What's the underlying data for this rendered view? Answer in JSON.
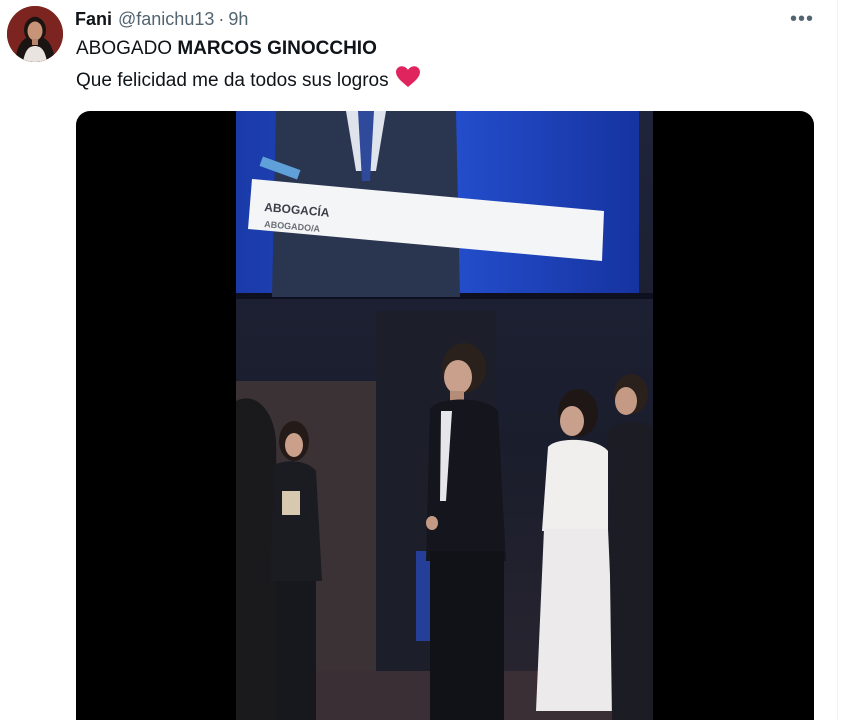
{
  "tweet": {
    "display_name": "Fani",
    "handle": "@fanichu13",
    "separator": "·",
    "time": "9h",
    "more_label": "•••",
    "text_line1_prefix": "ABOGADO ",
    "text_line1_bold": "MARCOS GINOCCHIO",
    "text_line2": "Que felicidad me da todos sus logros",
    "heart_emoji": "heart-emoji"
  },
  "media": {
    "lower_third_title": "ABOGACÍA",
    "lower_third_subtitle": "ABOGADO/A",
    "screen_color": "#1f3fb0",
    "background_color": "#000000"
  },
  "colors": {
    "text_primary": "#0f1419",
    "text_secondary": "#536471",
    "heart": "#f4212e"
  }
}
